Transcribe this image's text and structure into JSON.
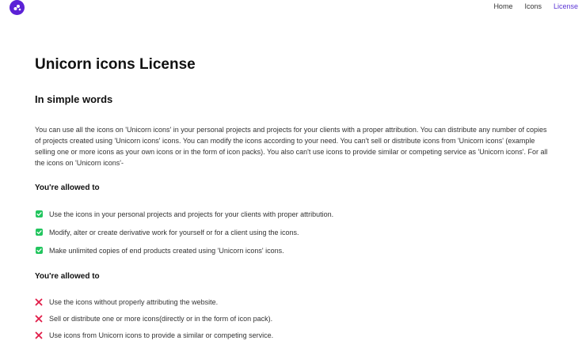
{
  "nav": {
    "links": [
      {
        "label": "Home"
      },
      {
        "label": "Icons"
      },
      {
        "label": "License"
      }
    ]
  },
  "page": {
    "title": "Unicorn icons License",
    "subtitle": "In simple words",
    "intro": "You can use all the icons on 'Unicorn icons' in your personal projects and projects for your clients with a proper attribution. You can distribute any number of copies of projects created using 'Unicorn icons' icons. You can modify the icons according to your need. You can't sell or distribute icons from 'Unicorn icons' (example selling one or more icons as your own icons or in the form of icon packs). You also can't use icons to provide similar or competing service as 'Unicorn icons'. For all the icons on 'Unicorn icons'-"
  },
  "allowed": {
    "heading": "You're allowed to",
    "items": [
      {
        "text": "Use the icons in your personal projects and projects for your clients with proper attribution."
      },
      {
        "text": "Modify, alter or create derivative work for yourself or for a client using the icons."
      },
      {
        "text": "Make unlimited copies of end products created using 'Unicorn icons' icons."
      }
    ]
  },
  "not_allowed": {
    "heading": "You're allowed to",
    "items": [
      {
        "text": "Use the icons without properly attributing the website."
      },
      {
        "text": "Sell or distribute one or more icons(directly or in the form of icon pack)."
      },
      {
        "text": "Use icons from Unicorn icons to provide a similar or competing service."
      }
    ]
  },
  "colors": {
    "brand": "#5b21d6",
    "check": "#22c55e",
    "cross": "#e11d48"
  }
}
